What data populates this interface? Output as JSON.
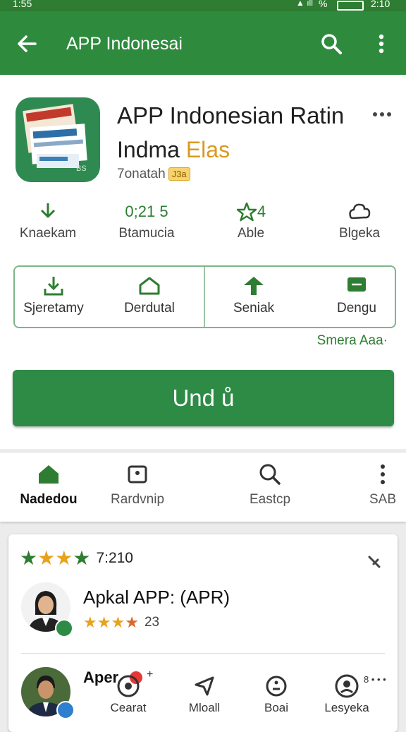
{
  "status_bar": {
    "time": "2:10",
    "left_text": "1:55",
    "battery": "%"
  },
  "app_bar": {
    "title": "APP Indonesai"
  },
  "app": {
    "title_line1": "APP Indonesian Ratin",
    "title_line2_main": "Indma",
    "title_line2_accent": "Elas",
    "developer": "7onatah",
    "badge": "J3a"
  },
  "stats": [
    {
      "value": "",
      "label": "Knaekam"
    },
    {
      "value": "0;21 5",
      "label": "Btamucia"
    },
    {
      "value": "4",
      "label": "Able"
    },
    {
      "value": "",
      "label": "Blgeka"
    }
  ],
  "features": [
    {
      "label": "Sjeretamy"
    },
    {
      "label": "Derdutal"
    },
    {
      "label": "Seniak"
    },
    {
      "label": "Dengu"
    }
  ],
  "see_more": "Smera Aaa·",
  "install_label": "Und ů",
  "tabs": [
    {
      "label": "Nadedou"
    },
    {
      "label": "Rardvnip"
    },
    {
      "label": "Eastcp"
    },
    {
      "label": "SAB"
    }
  ],
  "review_card": {
    "rating_text": "7:210",
    "reviewer1": {
      "name": "Apkal APP: (APR)",
      "count": "23"
    },
    "reviewer2": {
      "name": "Aper",
      "extra": "+"
    },
    "actions": [
      {
        "label": "Cearat"
      },
      {
        "label": "Mloall"
      },
      {
        "label": "Boai"
      },
      {
        "label": "Lesyeka"
      }
    ],
    "dots_text": "8 • • •"
  },
  "colors": {
    "primary": "#2e8b3e",
    "accent_star": "#e8a21c",
    "green_star": "#2e7d32"
  }
}
